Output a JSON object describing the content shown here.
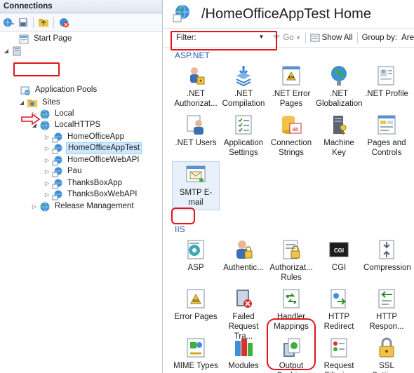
{
  "connections": {
    "title": "Connections",
    "toolbar_icons": [
      "connect-icon",
      "save-icon",
      "up-folder-icon",
      "disconnect-icon"
    ],
    "tree": [
      {
        "label": "Start Page",
        "icon": "start-page-icon",
        "expander": ""
      },
      {
        "label": "Application Pools",
        "icon": "app-pools-icon",
        "expander": ""
      },
      {
        "label": "Sites",
        "icon": "sites-folder-icon",
        "expander": "◢"
      },
      {
        "label": "Local",
        "icon": "globe-icon",
        "expander": "▷"
      },
      {
        "label": "LocalHTTPS",
        "icon": "globe-icon",
        "expander": "◢"
      },
      {
        "label": "HomeOfficeApp",
        "icon": "app-globe-icon",
        "expander": "▷"
      },
      {
        "label": "HomeOfficeAppTest",
        "icon": "app-globe-icon",
        "expander": "▷"
      },
      {
        "label": "HomeOfficeWebAPI",
        "icon": "app-globe-icon",
        "expander": "▷"
      },
      {
        "label": "Pau",
        "icon": "app-globe-icon",
        "expander": "▷"
      },
      {
        "label": "ThanksBoxApp",
        "icon": "app-globe-icon",
        "expander": "▷"
      },
      {
        "label": "ThanksBoxWebAPI",
        "icon": "app-globe-icon",
        "expander": "▷"
      },
      {
        "label": "Release Management",
        "icon": "globe-icon",
        "expander": "▷"
      }
    ]
  },
  "main": {
    "title": "/HomeOfficeAppTest Home",
    "filter_label": "Filter:",
    "filter_value": "",
    "go_label": "Go",
    "show_all_label": "Show All",
    "group_by_label": "Group by:",
    "group_by_value": "Are",
    "sections": [
      {
        "name": "ASP.NET",
        "features": [
          {
            "label": ".NET Authorizat...",
            "icon": "net-authorization-icon"
          },
          {
            "label": ".NET Compilation",
            "icon": "net-compilation-icon"
          },
          {
            "label": ".NET Error Pages",
            "icon": "net-error-pages-icon"
          },
          {
            "label": ".NET Globalization",
            "icon": "net-globalization-icon"
          },
          {
            "label": ".NET Profile",
            "icon": "net-profile-icon"
          },
          {
            "label": ".NET Users",
            "icon": "net-users-icon"
          },
          {
            "label": "Application Settings",
            "icon": "app-settings-icon"
          },
          {
            "label": "Connection Strings",
            "icon": "connection-strings-icon"
          },
          {
            "label": "Machine Key",
            "icon": "machine-key-icon"
          },
          {
            "label": "Pages and Controls",
            "icon": "pages-controls-icon"
          },
          {
            "label": "SMTP E-mail",
            "icon": "smtp-email-icon"
          }
        ]
      },
      {
        "name": "IIS",
        "features": [
          {
            "label": "ASP",
            "icon": "asp-icon"
          },
          {
            "label": "Authentic...",
            "icon": "authentication-icon"
          },
          {
            "label": "Authorizat... Rules",
            "icon": "authorization-rules-icon"
          },
          {
            "label": "CGI",
            "icon": "cgi-icon"
          },
          {
            "label": "Compression",
            "icon": "compression-icon"
          },
          {
            "label": "Error Pages",
            "icon": "error-pages-icon"
          },
          {
            "label": "Failed Request Tra...",
            "icon": "failed-request-tracing-icon"
          },
          {
            "label": "Handler Mappings",
            "icon": "handler-mappings-icon"
          },
          {
            "label": "HTTP Redirect",
            "icon": "http-redirect-icon"
          },
          {
            "label": "HTTP Respon...",
            "icon": "http-response-headers-icon"
          },
          {
            "label": "MIME Types",
            "icon": "mime-types-icon"
          },
          {
            "label": "Modules",
            "icon": "modules-icon"
          },
          {
            "label": "Output Caching",
            "icon": "output-caching-icon"
          },
          {
            "label": "Request Filtering",
            "icon": "request-filtering-icon"
          },
          {
            "label": "SSL Settings",
            "icon": "ssl-settings-icon"
          }
        ]
      }
    ]
  },
  "colors": {
    "highlight_red": "#e0141e",
    "section_blue": "#2a5db0",
    "selection": "#cde8ff"
  }
}
